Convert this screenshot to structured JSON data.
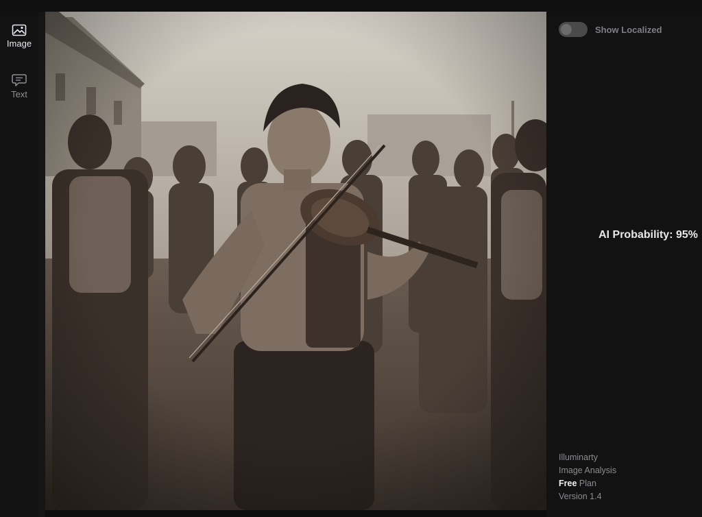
{
  "sidebar": {
    "items": [
      {
        "label": "Image",
        "icon": "image-icon",
        "active": true
      },
      {
        "label": "Text",
        "icon": "message-icon",
        "active": false
      }
    ]
  },
  "controls": {
    "show_localized_label": "Show Localized",
    "show_localized_on": false
  },
  "result": {
    "probability_text": "AI Probability: 95%"
  },
  "footer": {
    "app_name": "Illuminarty",
    "mode": "Image Analysis",
    "plan_tier": "Free",
    "plan_suffix": " Plan",
    "version": "Version 1.4"
  },
  "image": {
    "description_alt": "analyzed-image"
  },
  "colors": {
    "active_nav": "#e6e9f2",
    "inactive_nav": "#8d8f95",
    "accent_text": "#e8e8e8"
  }
}
